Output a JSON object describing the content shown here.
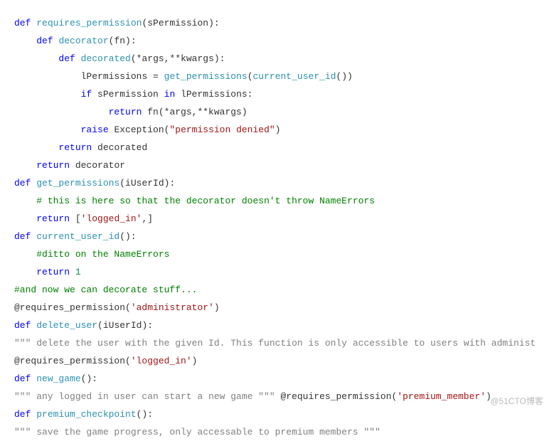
{
  "code": {
    "l1": {
      "kw": "def",
      "sp": " ",
      "fn": "requires_permission",
      "rest": "(sPermission):"
    },
    "l2": {
      "kw": "def",
      "sp": " ",
      "fn": "decorator",
      "rest": "(fn):"
    },
    "l3": {
      "kw": "def",
      "sp": " ",
      "fn": "decorated",
      "rest": "(*args,**kwargs):"
    },
    "l4": {
      "a": "lPermissions = ",
      "b": "get_permissions",
      "c": "(",
      "d": "current_user_id",
      "e": "())"
    },
    "l5": {
      "kw": "if",
      "a": " sPermission ",
      "kw2": "in",
      "b": " lPermissions:"
    },
    "l6": {
      "kw": "return",
      "a": " fn(*args,**kwargs)"
    },
    "l7": {
      "kw": "raise",
      "a": " Exception(",
      "str": "\"permission denied\"",
      "b": ")"
    },
    "l8": {
      "kw": "return",
      "a": " decorated"
    },
    "l9": {
      "kw": "return",
      "a": " decorator"
    },
    "l10": {
      "kw": "def",
      "sp": " ",
      "fn": "get_permissions",
      "rest": "(iUserId):"
    },
    "l11": {
      "cmt": "# this is here so that the decorator doesn't throw NameErrors"
    },
    "l12": {
      "kw": "return",
      "a": " [",
      "str": "'logged_in'",
      "b": ",]"
    },
    "l13": {
      "kw": "def",
      "sp": " ",
      "fn": "current_user_id",
      "rest": "():"
    },
    "l14": {
      "cmt": "#ditto on the NameErrors"
    },
    "l15": {
      "kw": "return",
      "a": " ",
      "num": "1"
    },
    "l16": {
      "cmt": "#and now we can decorate stuff..."
    },
    "l17": {
      "a": "@requires_permission(",
      "str": "'administrator'",
      "b": ")"
    },
    "l18": {
      "kw": "def",
      "sp": " ",
      "fn": "delete_user",
      "rest": "(iUserId):"
    },
    "l19": {
      "doc": "\"\"\" delete the user with the given Id. This function is only accessible to users with administ"
    },
    "l20": {
      "a": "@requires_permission(",
      "str": "'logged_in'",
      "b": ")"
    },
    "l21": {
      "kw": "def",
      "sp": " ",
      "fn": "new_game",
      "rest": "():"
    },
    "l22": {
      "doc": "\"\"\" any logged in user can start a new game \"\"\"",
      "a": " @requires_permission(",
      "str": "'premium_member'",
      "b": ")"
    },
    "l23": {
      "kw": "def",
      "sp": " ",
      "fn": "premium_checkpoint",
      "rest": "():"
    },
    "l24": {
      "doc": "\"\"\" save the game progress, only accessable to premium members \"\"\""
    }
  },
  "watermark": "@51CTO博客"
}
